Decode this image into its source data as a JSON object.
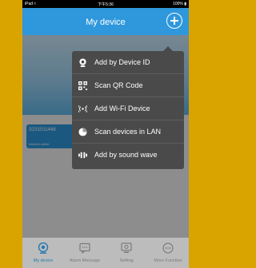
{
  "status_bar": {
    "left": "iPad ≈",
    "time": "下午5:36",
    "right": "100% ▮"
  },
  "header": {
    "title": "My device"
  },
  "device": {
    "id": "S231011448",
    "status": "Internet online"
  },
  "add_menu": {
    "items": [
      {
        "label": "Add by Device ID",
        "icon": "camera-icon"
      },
      {
        "label": "Scan QR Code",
        "icon": "qr-code-icon"
      },
      {
        "label": "Add Wi-Fi Device",
        "icon": "wifi-icon"
      },
      {
        "label": "Scan devices in LAN",
        "icon": "lan-scan-icon"
      },
      {
        "label": "Add by sound wave",
        "icon": "sound-wave-icon"
      }
    ]
  },
  "tabs": [
    {
      "label": "My device",
      "icon": "camera-icon",
      "active": true
    },
    {
      "label": "Alarm Message",
      "icon": "message-icon",
      "active": false
    },
    {
      "label": "Setting",
      "icon": "setting-icon",
      "active": false
    },
    {
      "label": "More Function",
      "icon": "more-icon",
      "active": false
    }
  ],
  "colors": {
    "accent": "#2f98dc",
    "menu_bg": "#4a4a4a",
    "frame": "#d9a300"
  }
}
